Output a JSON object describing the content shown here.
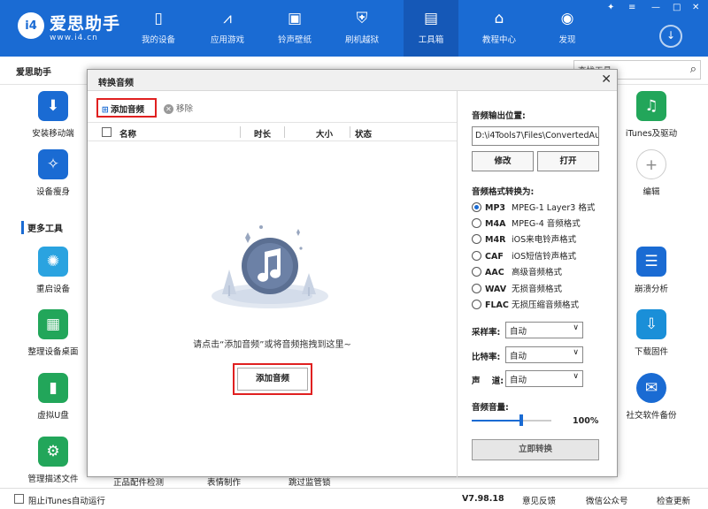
{
  "header": {
    "logo_text": "i4",
    "brand": "爱思助手",
    "url": "www.i4.cn",
    "nav": [
      {
        "label": "我的设备",
        "icon": "phone-icon"
      },
      {
        "label": "应用游戏",
        "icon": "app-store-icon"
      },
      {
        "label": "铃声壁纸",
        "icon": "ringtone-wallpaper-icon"
      },
      {
        "label": "刷机越狱",
        "icon": "flash-jailbreak-icon"
      },
      {
        "label": "工具箱",
        "icon": "toolbox-icon"
      },
      {
        "label": "教程中心",
        "icon": "tutorial-icon"
      },
      {
        "label": "发现",
        "icon": "discover-icon"
      }
    ],
    "active_index": 4
  },
  "background": {
    "tab": "爱思助手",
    "search_placeholder": "查找工具",
    "left_tools": [
      {
        "label": "安装移动端",
        "icon": "install-mobile-icon",
        "color": "#1a6bd3"
      },
      {
        "label": "设备瘦身",
        "icon": "broom-icon",
        "color": "#1a6bd3"
      },
      {
        "label": "重启设备",
        "icon": "restart-icon",
        "color": "#2aa3e0"
      },
      {
        "label": "整理设备桌面",
        "icon": "desktop-grid-icon",
        "color": "#22a65a"
      },
      {
        "label": "虚拟U盘",
        "icon": "usb-drive-icon",
        "color": "#22a65a"
      },
      {
        "label": "管理描述文件",
        "icon": "profile-icon",
        "color": "#22a65a"
      }
    ],
    "right_tools": [
      {
        "label": "iTunes及驱动",
        "icon": "itunes-icon",
        "color": "#22a65a"
      },
      {
        "label": "编辑",
        "icon": "plus-icon",
        "color": "#ffffff"
      },
      {
        "label": "崩溃分析",
        "icon": "crash-report-icon",
        "color": "#1a6bd3"
      },
      {
        "label": "下载固件",
        "icon": "download-firmware-icon",
        "color": "#1a8fd8"
      },
      {
        "label": "社交软件备份",
        "icon": "chat-backup-icon",
        "color": "#1a6bd3"
      }
    ],
    "section_title": "更多工具",
    "bottom_row": [
      "正品配件检测",
      "表情制作",
      "跳过监管锁"
    ]
  },
  "statusbar": {
    "itunes_block": "阻止iTunes自动运行",
    "version": "V7.98.18",
    "feedback": "意见反馈",
    "wechat": "微信公众号",
    "update": "检查更新"
  },
  "dialog": {
    "title": "转换音频",
    "add_label": "添加音频",
    "remove_label": "移除",
    "columns": [
      "名称",
      "时长",
      "大小",
      "状态"
    ],
    "hint": "请点击“添加音频”或将音频拖拽到这里~",
    "center_add_label": "添加音频",
    "output_label": "音频输出位置:",
    "output_path": "D:\\i4Tools7\\Files\\ConvertedAu",
    "modify_label": "修改",
    "open_label": "打开",
    "format_label": "音频格式转换为:",
    "formats": [
      {
        "code": "MP3",
        "desc": "MPEG-1 Layer3 格式",
        "selected": true
      },
      {
        "code": "M4A",
        "desc": "MPEG-4 音频格式",
        "selected": false
      },
      {
        "code": "M4R",
        "desc": "iOS来电铃声格式",
        "selected": false
      },
      {
        "code": "CAF",
        "desc": "iOS短信铃声格式",
        "selected": false
      },
      {
        "code": "AAC",
        "desc": "高级音频格式",
        "selected": false
      },
      {
        "code": "WAV",
        "desc": "无损音频格式",
        "selected": false
      },
      {
        "code": "FLAC",
        "desc": "无损压缩音频格式",
        "selected": false
      }
    ],
    "sample_rate_label": "采样率:",
    "sample_rate_value": "自动",
    "bitrate_label": "比特率:",
    "bitrate_value": "自动",
    "channel_label": "声    道:",
    "channel_value": "自动",
    "volume_label": "音频音量:",
    "volume_text": "100%",
    "volume_fraction": 0.62,
    "convert_label": "立即转换"
  },
  "colors": {
    "accent": "#1a6bd3",
    "highlight": "#e02020"
  }
}
